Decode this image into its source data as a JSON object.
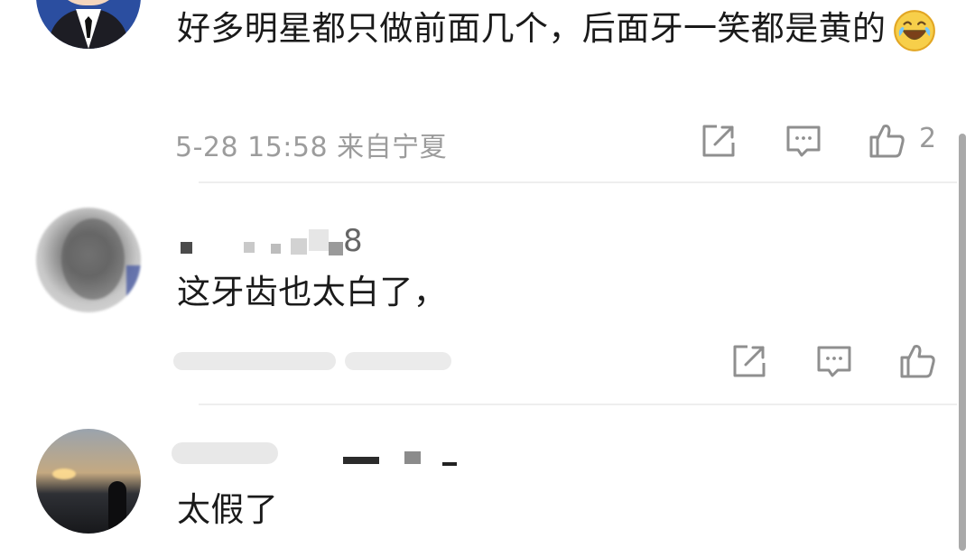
{
  "comments": [
    {
      "text": "好多明星都只做前面几个，后面牙一笑都是黄的",
      "emoji": "laughing-crying-emoji",
      "timestamp_location": "5-28 15:58 来自宁夏",
      "like_count": "2",
      "avatar": "cartoon-man-in-suit"
    },
    {
      "username_visible_fragment": "8",
      "text": "这牙齿也太白了，",
      "avatar": "blurred-photo"
    },
    {
      "text": "太假了",
      "avatar": "sunset-silhouette-photo"
    }
  ],
  "icons": {
    "share": "share-icon",
    "comment": "comment-icon",
    "like": "thumbs-up-icon"
  },
  "colors": {
    "text": "#1a1a1a",
    "meta": "#9c9c9c",
    "icon": "#8f8f8f",
    "divider": "#eeeeee",
    "scrollbar": "#a9a9a9"
  }
}
